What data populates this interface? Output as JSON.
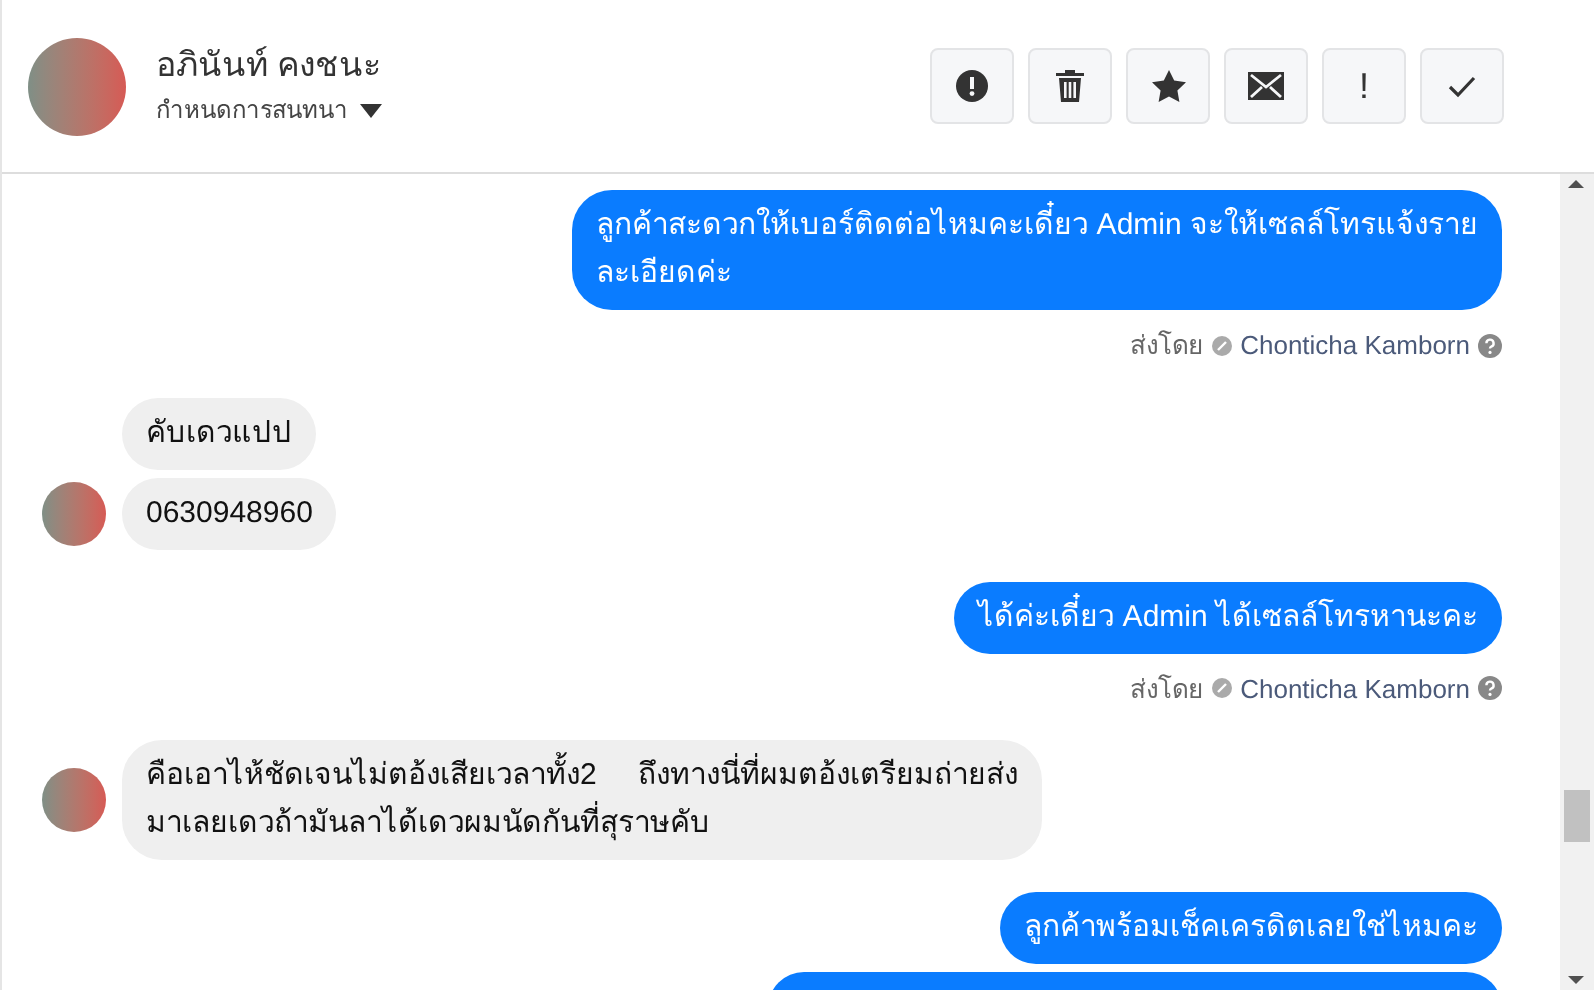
{
  "header": {
    "name": "อภินันท์ คงชนะ",
    "subtitle": "กำหนดการสนทนา",
    "actions": [
      {
        "kind": "alert"
      },
      {
        "kind": "trash"
      },
      {
        "kind": "star"
      },
      {
        "kind": "mail"
      },
      {
        "kind": "exclaim",
        "label": "!"
      },
      {
        "kind": "check"
      }
    ]
  },
  "messages": [
    {
      "kind": "outgoing",
      "bubbles": [
        {
          "text": "ลูกค้าสะดวกให้เบอร์ติดต่อไหมคะเดี๋ยว Admin จะให้เซลล์โทรแจ้งราย\nละเอียดค่ะ"
        }
      ],
      "sent_label": "ส่งโดย",
      "sender": "Chonticha Kamborn"
    },
    {
      "kind": "incoming",
      "bubbles": [
        {
          "text": "คับเดวแปป"
        },
        {
          "text": "0630948960"
        }
      ]
    },
    {
      "kind": "outgoing",
      "bubbles": [
        {
          "text": "ได้ค่ะเดี๋ยว Admin ได้เซลล์โทรหานะคะ"
        }
      ],
      "sent_label": "ส่งโดย",
      "sender": "Chonticha Kamborn"
    },
    {
      "kind": "incoming",
      "bubbles": [
        {
          "text": "คือเอาไห้ชัดเจนไม่ตอ้งเสียเวลาทั้ง2     ถึงทางนี่ที่ผมตอ้งเตรียมถ่ายส่ง\nมาเลยเดวถ้ามันลาได้เดวผมนัดกันที่สุราษคับ"
        }
      ]
    },
    {
      "kind": "outgoing",
      "bubbles": [
        {
          "text": "ลูกค้าพร้อมเช็คเครดิตเลยใช่ไหมคะ"
        },
        {
          "clipped": true
        }
      ]
    }
  ]
}
